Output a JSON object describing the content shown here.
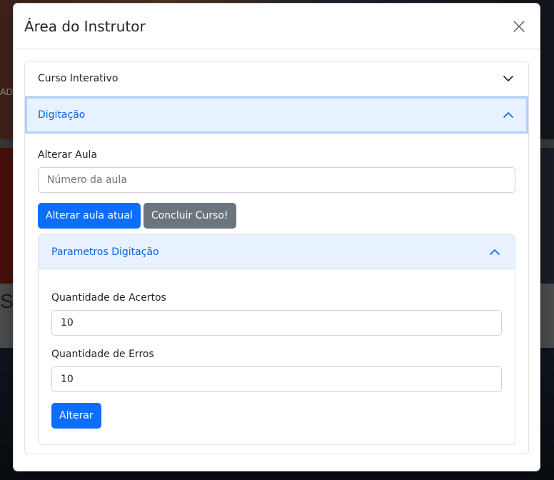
{
  "background": {
    "fragment_left_top": "ADI",
    "fragment_left_mid": "S"
  },
  "modal": {
    "title": "Área do Instrutor",
    "close_icon": "close-icon"
  },
  "accordion": {
    "item_1": {
      "label": "Curso Interativo",
      "state": "collapsed",
      "icon": "chevron-down-icon"
    },
    "item_2": {
      "label": "Digitação",
      "state": "expanded",
      "icon": "chevron-up-icon"
    }
  },
  "lesson": {
    "label": "Alterar Aula",
    "input_value": "",
    "input_placeholder": "Número da aula",
    "change_button": "Alterar aula atual",
    "finish_button": "Concluir Curso!"
  },
  "params": {
    "header": "Parametros Digitação",
    "state": "expanded",
    "icon": "chevron-up-icon",
    "hits_label": "Quantidade de Acertos",
    "hits_value": "10",
    "errors_label": "Quantidade de Erros",
    "errors_value": "10",
    "submit_button": "Alterar"
  },
  "colors": {
    "primary": "#0d6efd",
    "secondary": "#6c757d",
    "accordion_active_bg": "#e7f1ff",
    "accordion_active_text": "#0c63e4"
  }
}
